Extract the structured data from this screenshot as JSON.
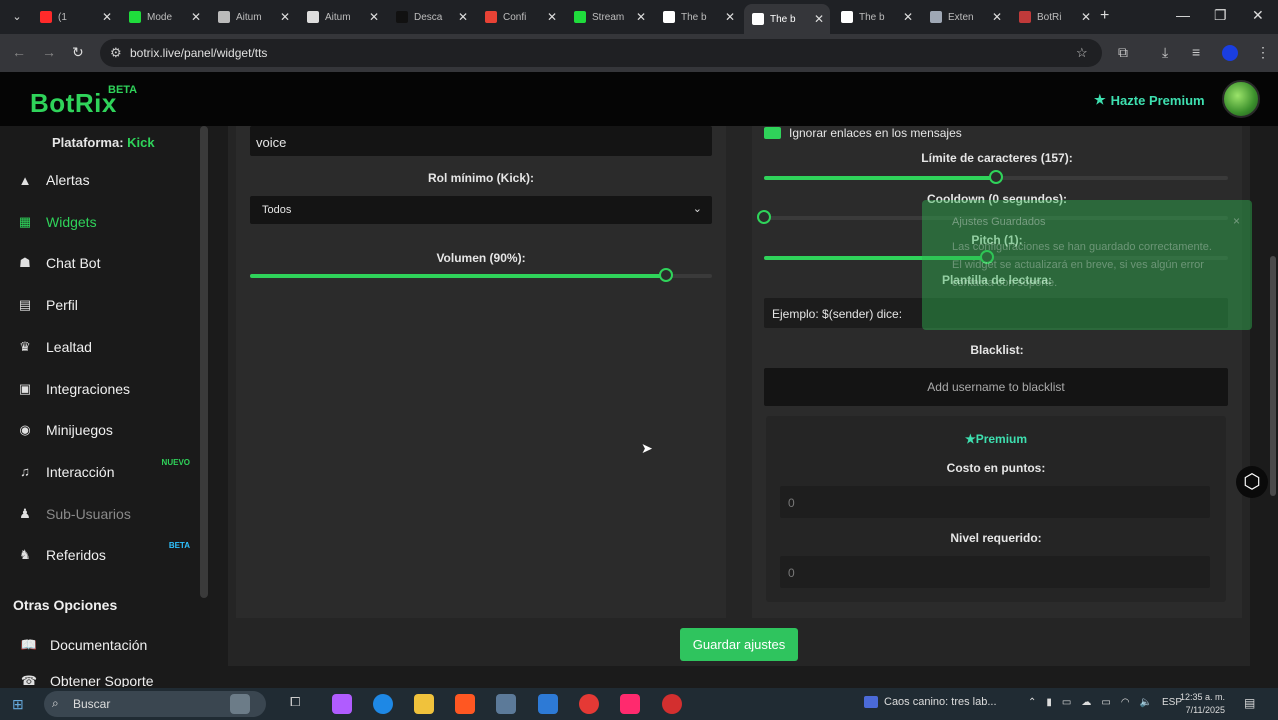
{
  "browser": {
    "tabs": [
      {
        "label": "(1",
        "color": "#ff2a2a"
      },
      {
        "label": "Mode",
        "color": "#1fdc3c"
      },
      {
        "label": "Aitum",
        "color": "#bbbbbb"
      },
      {
        "label": "Aitum",
        "color": "#dddddd"
      },
      {
        "label": "Desca",
        "color": "#111111"
      },
      {
        "label": "Confi",
        "color": "#e84235"
      },
      {
        "label": "Stream",
        "color": "#1fdc3c"
      },
      {
        "label": "The b",
        "color": "#ffffff"
      },
      {
        "label": "The b",
        "color": "#ffffff"
      },
      {
        "label": "The b",
        "color": "#ffffff"
      },
      {
        "label": "Exten",
        "color": "#9fa8b5"
      },
      {
        "label": "BotRi",
        "color": "#c03a3a"
      }
    ],
    "url": "botrix.live/panel/widget/tts"
  },
  "header": {
    "logo": "BotRix",
    "beta": "BETA",
    "premium_label": "Hazte Premium"
  },
  "sidebar": {
    "platform_label": "Plataforma:",
    "platform_value": "Kick",
    "items": [
      {
        "label": "Alertas",
        "icon": "warning-icon"
      },
      {
        "label": "Widgets",
        "icon": "widgets-icon"
      },
      {
        "label": "Chat Bot",
        "icon": "robot-icon"
      },
      {
        "label": "Perfil",
        "icon": "id-card-icon"
      },
      {
        "label": "Lealtad",
        "icon": "trophy-icon"
      },
      {
        "label": "Integraciones",
        "icon": "integrations-icon"
      },
      {
        "label": "Minijuegos",
        "icon": "gamepad-icon"
      },
      {
        "label": "Interacción",
        "icon": "music-icon",
        "badge": "NUEVO"
      },
      {
        "label": "Sub-Usuarios",
        "icon": "users-icon"
      },
      {
        "label": "Referidos",
        "icon": "referrals-icon",
        "badge": "BETA"
      }
    ],
    "other_title": "Otras Opciones",
    "docs_label": "Documentación",
    "support_label": "Obtener Soporte"
  },
  "left_panel": {
    "voice_value": "voice",
    "rol_label": "Rol mínimo (Kick):",
    "rol_selected": "Todos",
    "volume_label": "Volumen (90%):",
    "volume_value": 0.9
  },
  "right_panel": {
    "ignore_links_label": "Ignorar enlaces en los mensajes",
    "char_limit_label": "Límite de caracteres (157):",
    "char_limit_fraction": 0.5,
    "cooldown_label": "Cooldown (0 segundos):",
    "cooldown_fraction": 0.0,
    "pitch_label": "Pitch (1):",
    "pitch_fraction": 0.48,
    "template_label": "Plantilla de lectura:",
    "template_value": "Ejemplo: $(sender) dice:",
    "blacklist_label": "Blacklist:",
    "blacklist_placeholder": "Add username to blacklist",
    "premium_title": "Premium",
    "cost_label": "Costo en puntos:",
    "cost_placeholder": "0",
    "level_label": "Nivel requerido:",
    "level_placeholder": "0"
  },
  "save_button": "Guardar ajustes",
  "toast": {
    "title": "Ajustes Guardados",
    "body": "Las configuraciones se han guardado correctamente. El widget se actualizará en breve, si ves algún error contacta con soporte.",
    "close": "×"
  },
  "taskbar": {
    "search_placeholder": "Buscar",
    "news": "Caos canino: tres lab...",
    "lang": "ESP",
    "time": "12:35 a. m.",
    "date": "7/11/2025"
  }
}
